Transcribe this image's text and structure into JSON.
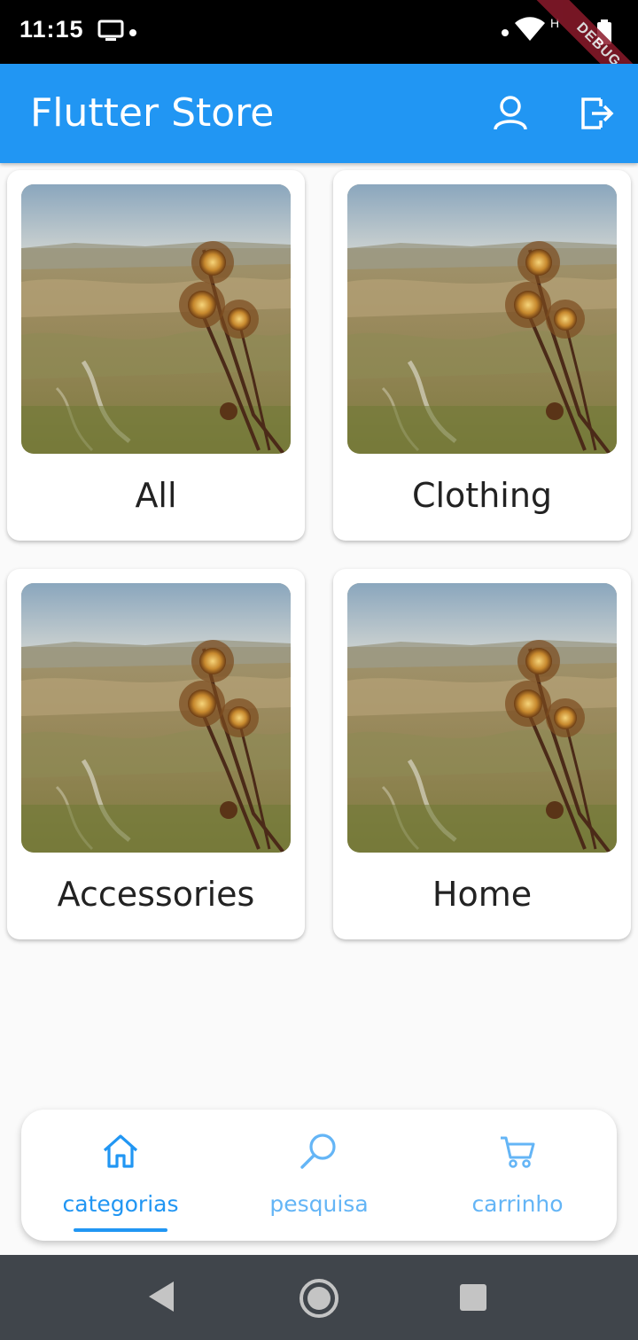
{
  "status_bar": {
    "time": "11:15",
    "network_label": "H",
    "debug_banner": "DEBUG"
  },
  "app_bar": {
    "title": "Flutter Store",
    "background": "#2196f3",
    "icons": [
      "person-outline-icon",
      "exit-to-app-icon"
    ]
  },
  "categories": [
    {
      "label": "All",
      "image": "thistle-landscape-photo"
    },
    {
      "label": "Clothing",
      "image": "thistle-landscape-photo"
    },
    {
      "label": "Accessories",
      "image": "thistle-landscape-photo"
    },
    {
      "label": "Home",
      "image": "thistle-landscape-photo"
    }
  ],
  "bottom_nav": {
    "items": [
      {
        "label": "categorias",
        "icon": "home-icon",
        "active": true
      },
      {
        "label": "pesquisa",
        "icon": "search-icon",
        "active": false
      },
      {
        "label": "carrinho",
        "icon": "cart-icon",
        "active": false
      }
    ],
    "active_color": "#2196f3",
    "inactive_color": "#64b5f6"
  },
  "system_nav": {
    "buttons": [
      "back-icon",
      "home-circle-icon",
      "recents-icon"
    ]
  }
}
